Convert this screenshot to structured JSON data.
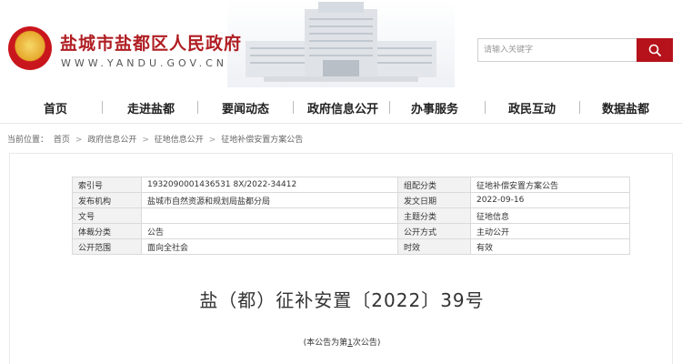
{
  "header": {
    "site_name": "盐城市盐都区人民政府",
    "site_url": "WWW.YANDU.GOV.CN",
    "search_placeholder": "请输入关键字"
  },
  "nav": {
    "items": [
      "首页",
      "走进盐都",
      "要闻动态",
      "政府信息公开",
      "办事服务",
      "政民互动",
      "数据盐都"
    ]
  },
  "breadcrumb": {
    "label": "当前位置：",
    "items": [
      "首页",
      "政府信息公开",
      "征地信息公开",
      "征地补偿安置方案公告"
    ]
  },
  "meta": {
    "rows": [
      {
        "l1": "索引号",
        "v1": "1932090001436531 8X/2022-34412",
        "l2": "组配分类",
        "v2": "征地补偿安置方案公告"
      },
      {
        "l1": "发布机构",
        "v1": "盐城市自然资源和规划局盐都分局",
        "l2": "发文日期",
        "v2": "2022-09-16"
      },
      {
        "l1": "文号",
        "v1": "",
        "l2": "主题分类",
        "v2": "征地信息"
      },
      {
        "l1": "体裁分类",
        "v1": "公告",
        "l2": "公开方式",
        "v2": "主动公开"
      },
      {
        "l1": "公开范围",
        "v1": "面向全社会",
        "l2": "时效",
        "v2": "有效"
      }
    ]
  },
  "doc": {
    "title": "盐（都）征补安置〔2022〕39号",
    "note_prefix": "(本公告为第",
    "note_num": "1",
    "note_suffix": "次公告)"
  },
  "colors": {
    "brand_red": "#b01e23",
    "search_btn": "#b5121b"
  }
}
